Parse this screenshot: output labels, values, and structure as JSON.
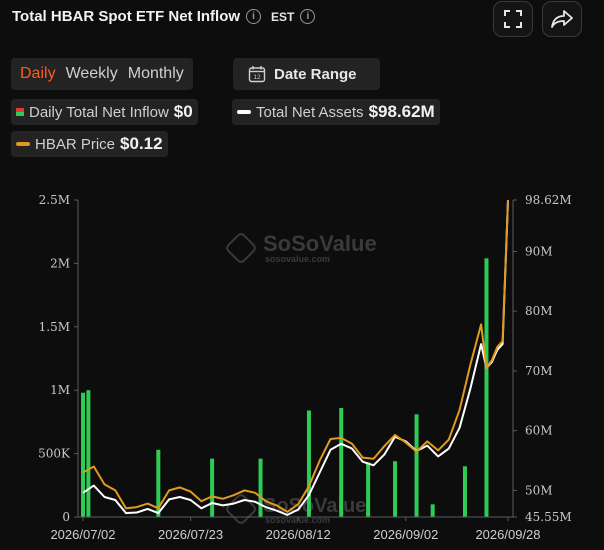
{
  "header": {
    "title": "Total HBAR Spot ETF Net Inflow",
    "timezone": "EST"
  },
  "toolbar": {
    "expand_icon": "expand-icon",
    "share_icon": "share-icon"
  },
  "tabs": [
    {
      "label": "Daily",
      "active": true
    },
    {
      "label": "Weekly",
      "active": false
    },
    {
      "label": "Monthly",
      "active": false
    }
  ],
  "date_range": {
    "label": "Date Range",
    "icon": "calendar-icon",
    "day": "12"
  },
  "legend": {
    "inflow": {
      "label": "Daily Total Net Inflow",
      "value": "$0"
    },
    "assets": {
      "label": "Total Net Assets",
      "value": "$98.62M",
      "color": "#ffffff"
    },
    "price": {
      "label": "HBAR Price",
      "value": "$0.12",
      "color": "#e09a1e"
    }
  },
  "watermark": {
    "brand": "SoSoValue",
    "url": "sosovalue.com"
  },
  "chart_data": {
    "type": "bar",
    "n_points": 63,
    "x_tick_labels": [
      "2026/07/02",
      "2026/07/23",
      "2026/08/12",
      "2026/09/02",
      "2026/09/28"
    ],
    "y_left_ticks": [
      "0",
      "500K",
      "1M",
      "1.5M",
      "2M",
      "2.5M"
    ],
    "ylim_left": [
      0,
      2500000
    ],
    "y_right_ticks": [
      "45.55M",
      "50M",
      "60M",
      "70M",
      "80M",
      "90M",
      "98.62M"
    ],
    "ylim_right": [
      45.55,
      98.62
    ],
    "bar_color": "#2ecc55",
    "bars": [
      {
        "i": 0,
        "v": 980000
      },
      {
        "i": 1,
        "v": 1000000
      },
      {
        "i": 14,
        "v": 530000
      },
      {
        "i": 24,
        "v": 460000
      },
      {
        "i": 33,
        "v": 460000
      },
      {
        "i": 42,
        "v": 840000
      },
      {
        "i": 48,
        "v": 860000
      },
      {
        "i": 53,
        "v": 430000
      },
      {
        "i": 58,
        "v": 440000
      },
      {
        "i": 62,
        "v": 810000
      },
      {
        "i": 65,
        "v": 100000
      },
      {
        "i": 71,
        "v": 400000
      },
      {
        "i": 75,
        "v": 2040000
      }
    ],
    "x_index_max": 79,
    "series": [
      {
        "name": "Total Net Assets",
        "color": "#ffffff",
        "values": [
          [
            0,
            49.6
          ],
          [
            2,
            50.8
          ],
          [
            4,
            48.9
          ],
          [
            6,
            48.4
          ],
          [
            8,
            46.2
          ],
          [
            10,
            46.3
          ],
          [
            12,
            46.9
          ],
          [
            14,
            46.2
          ],
          [
            16,
            48.5
          ],
          [
            18,
            48.9
          ],
          [
            20,
            48.4
          ],
          [
            22,
            47.0
          ],
          [
            24,
            47.9
          ],
          [
            26,
            47.5
          ],
          [
            28,
            47.8
          ],
          [
            30,
            48.4
          ],
          [
            32,
            48.1
          ],
          [
            34,
            47.2
          ],
          [
            36,
            46.6
          ],
          [
            38,
            45.9
          ],
          [
            40,
            46.8
          ],
          [
            42,
            49.2
          ],
          [
            44,
            53.0
          ],
          [
            46,
            56.8
          ],
          [
            48,
            57.8
          ],
          [
            50,
            57.0
          ],
          [
            52,
            54.8
          ],
          [
            54,
            54.2
          ],
          [
            56,
            56.0
          ],
          [
            58,
            59.0
          ],
          [
            60,
            58.2
          ],
          [
            62,
            56.6
          ],
          [
            64,
            57.5
          ],
          [
            66,
            55.7
          ],
          [
            68,
            57.0
          ],
          [
            70,
            60.5
          ],
          [
            72,
            67.0
          ],
          [
            74,
            74.5
          ],
          [
            75,
            70.5
          ],
          [
            76,
            71.5
          ],
          [
            77,
            73.5
          ],
          [
            78,
            74.5
          ],
          [
            79,
            98.62
          ]
        ]
      },
      {
        "name": "HBAR Price",
        "color": "#e09a1e",
        "values": [
          [
            0,
            53.0
          ],
          [
            2,
            54.0
          ],
          [
            4,
            51.0
          ],
          [
            6,
            50.0
          ],
          [
            8,
            47.0
          ],
          [
            10,
            47.2
          ],
          [
            12,
            47.8
          ],
          [
            14,
            47.0
          ],
          [
            16,
            50.0
          ],
          [
            18,
            50.5
          ],
          [
            20,
            49.8
          ],
          [
            22,
            48.2
          ],
          [
            24,
            49.0
          ],
          [
            26,
            48.6
          ],
          [
            28,
            49.2
          ],
          [
            30,
            50.0
          ],
          [
            32,
            49.6
          ],
          [
            34,
            48.2
          ],
          [
            36,
            47.5
          ],
          [
            38,
            46.4
          ],
          [
            40,
            47.7
          ],
          [
            42,
            50.7
          ],
          [
            44,
            55.0
          ],
          [
            46,
            58.6
          ],
          [
            48,
            58.8
          ],
          [
            50,
            57.8
          ],
          [
            52,
            55.5
          ],
          [
            54,
            55.3
          ],
          [
            56,
            57.4
          ],
          [
            58,
            59.3
          ],
          [
            60,
            58.0
          ],
          [
            62,
            56.5
          ],
          [
            64,
            58.2
          ],
          [
            66,
            56.7
          ],
          [
            68,
            58.5
          ],
          [
            70,
            63.5
          ],
          [
            72,
            71.0
          ],
          [
            74,
            77.8
          ],
          [
            75,
            70.5
          ],
          [
            76,
            71.8
          ],
          [
            77,
            74.0
          ],
          [
            78,
            75.0
          ],
          [
            79,
            98.62
          ]
        ]
      }
    ]
  }
}
